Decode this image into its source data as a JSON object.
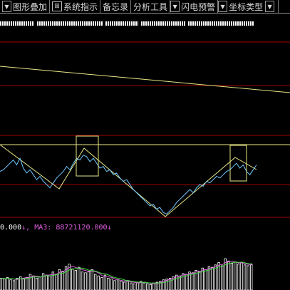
{
  "toolbar": {
    "items": [
      {
        "label": "图形叠加",
        "arrow": "▼",
        "icon": "⊞"
      },
      {
        "label": "系统指示"
      },
      {
        "label": "备忘录"
      },
      {
        "label": "分析工具"
      },
      {
        "label": "闪电预警"
      },
      {
        "label": "坐标类型"
      }
    ],
    "dropdown_arrow": "▼"
  },
  "indicator_legend": {
    "first_value": "0.000",
    "first_arrow": "↓",
    "ma3_label": "MA3:",
    "ma3_value": "88721120.000",
    "ma3_arrow": "↓"
  },
  "colors": {
    "background": "#000000",
    "price_line": "#6ec8ff",
    "trend_line": "#e8e888",
    "grid_line": "#a00000",
    "volume_bar": "#ffffff",
    "ma_magenta": "#e060e0",
    "ma_green": "#40e040",
    "highlight_box": "#e8e888"
  },
  "chart_data": {
    "type": "line",
    "price_series": [
      0.56,
      0.58,
      0.62,
      0.66,
      0.7,
      0.64,
      0.72,
      0.6,
      0.54,
      0.58,
      0.52,
      0.46,
      0.5,
      0.44,
      0.4,
      0.36,
      0.42,
      0.48,
      0.52,
      0.56,
      0.62,
      0.58,
      0.66,
      0.72,
      0.7,
      0.76,
      0.74,
      0.68,
      0.72,
      0.66,
      0.6,
      0.62,
      0.56,
      0.58,
      0.52,
      0.54,
      0.48,
      0.44,
      0.46,
      0.4,
      0.34,
      0.3,
      0.26,
      0.22,
      0.18,
      0.14,
      0.16,
      0.1,
      0.12,
      0.06,
      0.04,
      0.08,
      0.12,
      0.18,
      0.22,
      0.26,
      0.3,
      0.34,
      0.3,
      0.36,
      0.4,
      0.38,
      0.44,
      0.42,
      0.46,
      0.5,
      0.48,
      0.52,
      0.56,
      0.58,
      0.62,
      0.66,
      0.6,
      0.64,
      0.56,
      0.52,
      0.58,
      0.64
    ],
    "volume": [
      0.3,
      0.28,
      0.32,
      0.26,
      0.24,
      0.3,
      0.34,
      0.28,
      0.32,
      0.4,
      0.36,
      0.3,
      0.34,
      0.42,
      0.38,
      0.36,
      0.46,
      0.4,
      0.52,
      0.48,
      0.6,
      0.66,
      0.54,
      0.5,
      0.58,
      0.46,
      0.44,
      0.48,
      0.52,
      0.4,
      0.36,
      0.32,
      0.38,
      0.3,
      0.28,
      0.24,
      0.26,
      0.22,
      0.2,
      0.24,
      0.18,
      0.16,
      0.2,
      0.22,
      0.18,
      0.16,
      0.14,
      0.18,
      0.2,
      0.22,
      0.26,
      0.28,
      0.3,
      0.34,
      0.38,
      0.36,
      0.42,
      0.4,
      0.46,
      0.44,
      0.5,
      0.48,
      0.56,
      0.52,
      0.6,
      0.58,
      0.64,
      0.7,
      0.62,
      0.8,
      0.74,
      0.68,
      0.72,
      0.66,
      0.7,
      0.64,
      0.62,
      0.66
    ]
  }
}
